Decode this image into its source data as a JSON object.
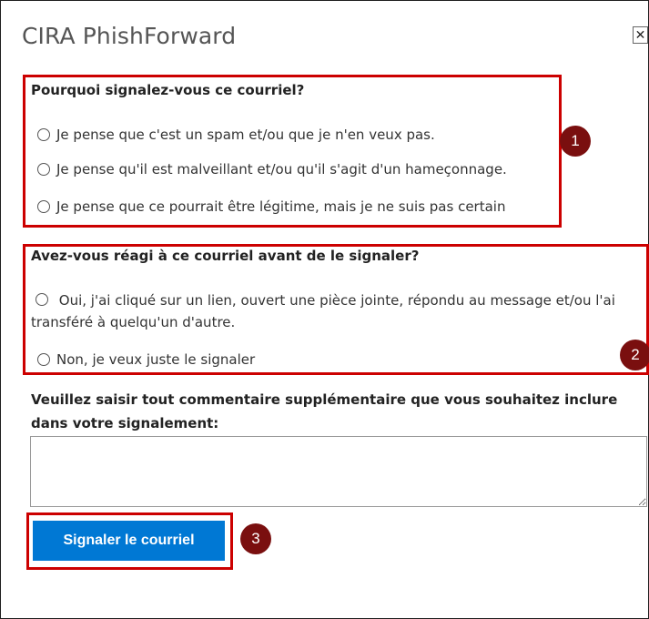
{
  "app": {
    "title": "CIRA PhishForward",
    "close_glyph": "✕"
  },
  "question1": {
    "label": "Pourquoi signalez-vous ce courriel?",
    "options": [
      "Je pense que c'est un spam et/ou que je n'en veux pas.",
      "Je pense qu'il est malveillant et/ou qu'il s'agit d'un hameçonnage.",
      "Je pense que ce pourrait être légitime, mais je ne suis pas certain"
    ]
  },
  "question2": {
    "label": "Avez-vous réagi à ce courriel avant de le signaler?",
    "options": [
      "Oui, j'ai cliqué sur un lien, ouvert une pièce jointe, répondu au message et/ou l'ai transféré à quelqu'un d'autre.",
      "Non, je veux juste le signaler"
    ]
  },
  "comment": {
    "label_line1": "Veuillez saisir tout commentaire supplémentaire que vous souhaitez inclure",
    "label_line2": "dans votre signalement:",
    "value": ""
  },
  "submit": {
    "label": "Signaler le courriel"
  },
  "annotations": {
    "badge1": "1",
    "badge2": "2",
    "badge3": "3",
    "color": "#cc0000"
  }
}
